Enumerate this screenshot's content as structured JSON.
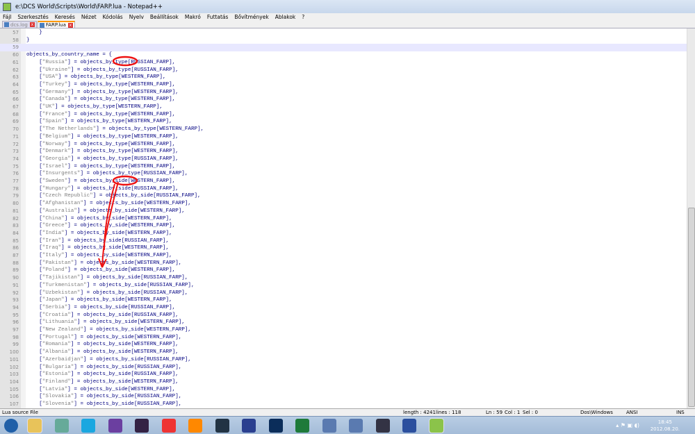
{
  "window": {
    "title": "e:\\DCS World\\Scripts\\World\\FARP.lua - Notepad++"
  },
  "menu": [
    "Fájl",
    "Szerkesztés",
    "Keresés",
    "Nézet",
    "Kódolás",
    "Nyelv",
    "Beállítások",
    "Makró",
    "Futtatás",
    "Bővítmények",
    "Ablakok",
    "?"
  ],
  "tabs": [
    {
      "label": "dcs.log",
      "active": false
    },
    {
      "label": "FARP.lua",
      "active": true
    }
  ],
  "editor": {
    "current_line": 59,
    "head": [
      {
        "n": 57,
        "code": "    }"
      },
      {
        "n": 58,
        "code": "}"
      },
      {
        "n": 59,
        "code": ""
      },
      {
        "n": 60,
        "code": "objects_by_country_name = {"
      }
    ],
    "entries": [
      [
        "61",
        "Russia",
        "type",
        "RUSSIAN_FARP"
      ],
      [
        "62",
        "Ukraine",
        "type",
        "RUSSIAN_FARP"
      ],
      [
        "63",
        "USA",
        "type",
        "WESTERN_FARP"
      ],
      [
        "64",
        "Turkey",
        "type",
        "WESTERN_FARP"
      ],
      [
        "65",
        "Germany",
        "type",
        "WESTERN_FARP"
      ],
      [
        "66",
        "Canada",
        "type",
        "WESTERN_FARP"
      ],
      [
        "67",
        "UK",
        "type",
        "WESTERN_FARP"
      ],
      [
        "68",
        "France",
        "type",
        "WESTERN_FARP"
      ],
      [
        "69",
        "Spain",
        "type",
        "WESTERN_FARP"
      ],
      [
        "70",
        "The Netherlands",
        "type",
        "WESTERN_FARP"
      ],
      [
        "71",
        "Belgium",
        "type",
        "WESTERN_FARP"
      ],
      [
        "72",
        "Norway",
        "type",
        "WESTERN_FARP"
      ],
      [
        "73",
        "Denmark",
        "type",
        "WESTERN_FARP"
      ],
      [
        "74",
        "Georgia",
        "type",
        "RUSSIAN_FARP"
      ],
      [
        "75",
        "Israel",
        "type",
        "WESTERN_FARP"
      ],
      [
        "76",
        "Insurgents",
        "type",
        "RUSSIAN_FARP"
      ],
      [
        "77",
        "Sweden",
        "side",
        "WESTERN_FARP"
      ],
      [
        "78",
        "Hungary",
        "side",
        "RUSSIAN_FARP"
      ],
      [
        "79",
        "Czech Republic",
        "side",
        "RUSSIAN_FARP"
      ],
      [
        "80",
        "Afghanistan",
        "side",
        "WESTERN_FARP"
      ],
      [
        "81",
        "Australia",
        "side",
        "WESTERN_FARP"
      ],
      [
        "82",
        "China",
        "side",
        "WESTERN_FARP"
      ],
      [
        "83",
        "Greece",
        "side",
        "WESTERN_FARP"
      ],
      [
        "84",
        "India",
        "side",
        "WESTERN_FARP"
      ],
      [
        "85",
        "Iran",
        "side",
        "RUSSIAN_FARP"
      ],
      [
        "86",
        "Iraq",
        "side",
        "WESTERN_FARP"
      ],
      [
        "87",
        "Italy",
        "side",
        "WESTERN_FARP"
      ],
      [
        "88",
        "Pakistan",
        "side",
        "WESTERN_FARP"
      ],
      [
        "89",
        "Poland",
        "side",
        "WESTERN_FARP"
      ],
      [
        "90",
        "Tajikistan",
        "side",
        "RUSSIAN_FARP"
      ],
      [
        "91",
        "Turkmenistan",
        "side",
        "RUSSIAN_FARP"
      ],
      [
        "92",
        "Uzbekistan",
        "side",
        "RUSSIAN_FARP"
      ],
      [
        "93",
        "Japan",
        "side",
        "WESTERN_FARP"
      ],
      [
        "94",
        "Serbia",
        "side",
        "RUSSIAN_FARP"
      ],
      [
        "95",
        "Croatia",
        "side",
        "RUSSIAN_FARP"
      ],
      [
        "96",
        "Lithuania",
        "side",
        "WESTERN_FARP"
      ],
      [
        "97",
        "New Zealand",
        "side",
        "WESTERN_FARP"
      ],
      [
        "98",
        "Portugal",
        "side",
        "WESTERN_FARP"
      ],
      [
        "99",
        "Romania",
        "side",
        "WESTERN_FARP"
      ],
      [
        "100",
        "Albania",
        "side",
        "WESTERN_FARP"
      ],
      [
        "101",
        "Azerbaidjan",
        "side",
        "RUSSIAN_FARP"
      ],
      [
        "102",
        "Bulgaria",
        "side",
        "RUSSIAN_FARP"
      ],
      [
        "103",
        "Estonia",
        "side",
        "RUSSIAN_FARP"
      ],
      [
        "104",
        "Finland",
        "side",
        "WESTERN_FARP"
      ],
      [
        "105",
        "Latvia",
        "side",
        "WESTERN_FARP"
      ],
      [
        "106",
        "Slovakia",
        "side",
        "RUSSIAN_FARP"
      ],
      [
        "107",
        "Slovenia",
        "side",
        "RUSSIAN_FARP"
      ]
    ]
  },
  "status": {
    "file_type": "Lua source File",
    "length": "length : 4241",
    "lines": "lines : 118",
    "ln": "Ln : 59",
    "col": "Col : 1",
    "sel": "Sel : 0",
    "eol": "Dos\\Windows",
    "encoding": "ANSI",
    "mode": "INS"
  },
  "taskbar": {
    "time": "18:45",
    "date": "2012.08.20.",
    "icons": [
      "start-orb",
      "explorer",
      "app",
      "skype",
      "app",
      "eclipse",
      "chrome",
      "firefox",
      "app",
      "save",
      "photoshop",
      "excel",
      "network",
      "network",
      "airplane",
      "globe",
      "notepad-plus-plus"
    ]
  },
  "colors": {
    "keyword": "#000080",
    "string": "#808080",
    "annotation": "#ee1111"
  }
}
